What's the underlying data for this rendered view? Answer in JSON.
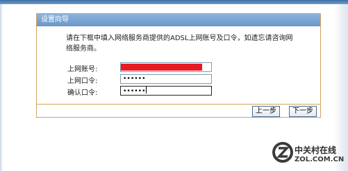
{
  "window": {
    "header_title": "设置向导",
    "description": "请在下框中填入网络服务商提供的ADSL上网账号及口令，如遗忘请咨询网络服务商。"
  },
  "form": {
    "account": {
      "label": "上网账号:",
      "value": ""
    },
    "password": {
      "label": "上网口令:",
      "value": "••••••"
    },
    "confirm": {
      "label": "确认口令:",
      "value": "••••••"
    }
  },
  "buttons": {
    "prev": "上一步",
    "next": "下一步"
  },
  "watermark": {
    "text_cn": "中关村在线",
    "text_en": "ZOL.COM.CN"
  }
}
